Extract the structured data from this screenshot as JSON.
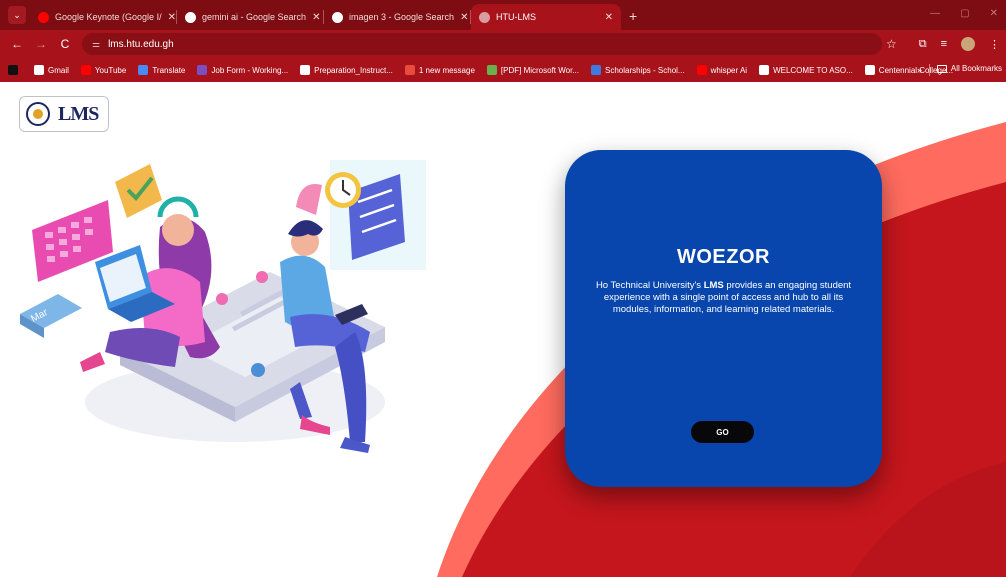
{
  "browser": {
    "tabs": [
      {
        "title": "Google Keynote (Google I/",
        "favicon": "youtube-icon",
        "color": "#ff0000"
      },
      {
        "title": "gemini ai - Google Search",
        "favicon": "google-icon",
        "color": "#ffffff"
      },
      {
        "title": "imagen 3 - Google Search",
        "favicon": "google-icon",
        "color": "#ffffff"
      },
      {
        "title": "HTU-LMS",
        "favicon": "globe-icon",
        "color": "#d99aa0",
        "active": true
      }
    ],
    "url": "lms.htu.edu.gh",
    "bookmarks": [
      {
        "label": "",
        "icon": "chat-icon"
      },
      {
        "label": "Gmail",
        "icon": "gmail-icon"
      },
      {
        "label": "YouTube",
        "icon": "youtube-icon"
      },
      {
        "label": "Translate",
        "icon": "translate-icon"
      },
      {
        "label": "Job Form - Working...",
        "icon": "form-icon"
      },
      {
        "label": "Preparation_Instruct...",
        "icon": "globe-icon"
      },
      {
        "label": "1 new message",
        "icon": "message-icon"
      },
      {
        "label": "[PDF] Microsoft Wor...",
        "icon": "pdf-icon"
      },
      {
        "label": "Scholarships - Schol...",
        "icon": "scholarship-icon"
      },
      {
        "label": "whisper Ai",
        "icon": "youtube-icon"
      },
      {
        "label": "WELCOME TO ASO...",
        "icon": "globe-icon"
      },
      {
        "label": "Centennial College...",
        "icon": "college-icon"
      }
    ],
    "more_label": "»",
    "all_bookmarks": "All Bookmarks"
  },
  "page": {
    "logo_text": "LMS",
    "card": {
      "title": "WOEZOR",
      "desc_before": "Ho Technical University's ",
      "desc_bold": "LMS",
      "desc_after": " provides an engaging student experience with a single point of access and hub to all its modules, information, and learning related materials.",
      "button": "GO"
    },
    "illustration_month": "Mar"
  },
  "colors": {
    "chrome": "#a8121b",
    "tabstrip": "#7d0d13",
    "card": "#0846ad",
    "wave_dark": "#c4161c",
    "wave_light": "#ff6b5e"
  }
}
